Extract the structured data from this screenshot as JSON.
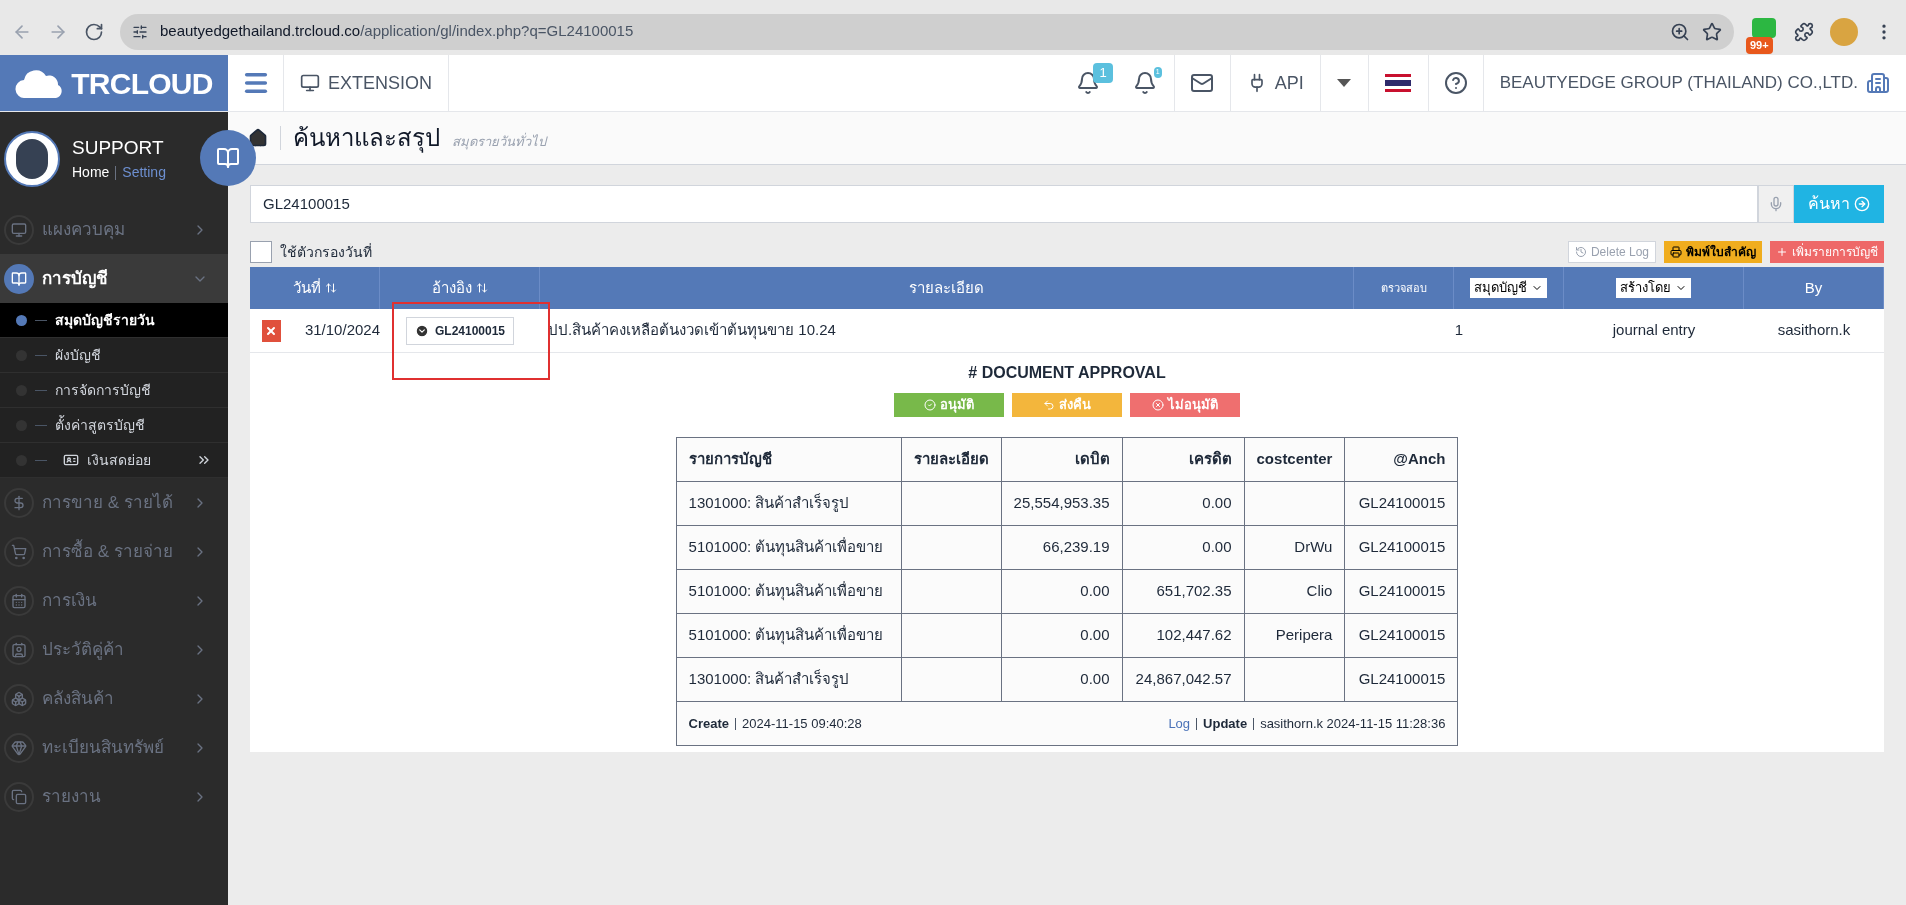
{
  "browser": {
    "url_host": "beautyedgethailand.trcloud.co",
    "url_path": "/application/gl/index.php?q=GL24100015",
    "extension_badge": "99+"
  },
  "topbar": {
    "logo": "TRCLOUD",
    "extension": "EXTENSION",
    "notifications": [
      "1",
      "1"
    ],
    "api": "API",
    "company": "BEAUTYEDGE GROUP (THAILAND) CO.,LTD."
  },
  "profile": {
    "name": "SUPPORT",
    "links": [
      "Home",
      "Setting"
    ]
  },
  "sidebar": {
    "items": [
      {
        "label": "แผงควบคุม",
        "expanded": false
      },
      {
        "label": "การบัญชี",
        "expanded": true,
        "children": [
          {
            "label": "สมุดบัญชีรายวัน",
            "selected": true,
            "kind": "link"
          },
          {
            "label": "ผังบัญชี",
            "selected": false,
            "kind": "link"
          },
          {
            "label": "การจัดการบัญชี",
            "selected": false,
            "kind": "link"
          },
          {
            "label": "ตั้งค่าสูตรบัญชี",
            "selected": false,
            "kind": "link"
          },
          {
            "label": "เงินสดย่อย",
            "selected": false,
            "kind": "group"
          }
        ]
      },
      {
        "label": "การขาย & รายได้",
        "expanded": false
      },
      {
        "label": "การซื้อ & รายจ่าย",
        "expanded": false
      },
      {
        "label": "การเงิน",
        "expanded": false
      },
      {
        "label": "ประวัติคู่ค้า",
        "expanded": false
      },
      {
        "label": "คลังสินค้า",
        "expanded": false
      },
      {
        "label": "ทะเบียนสินทรัพย์",
        "expanded": false
      },
      {
        "label": "รายงาน",
        "expanded": false
      }
    ]
  },
  "page": {
    "title": "ค้นหาและสรุป",
    "subtitle": "สมุดรายวันทั่วไป"
  },
  "search": {
    "value": "GL24100015",
    "button": "ค้นหา"
  },
  "filter": {
    "label": "ใช้ตัวกรองวันที่",
    "checked": false
  },
  "actions": [
    {
      "label": "Delete Log",
      "kind": "log"
    },
    {
      "label": "พิมพ์ใบสำคัญ",
      "kind": "print"
    },
    {
      "label": "เพิ่มรายการบัญชี",
      "kind": "add"
    }
  ],
  "table": {
    "columns": [
      {
        "label": "วันที่",
        "kind": "sort"
      },
      {
        "label": "อ้างอิง",
        "kind": "sort"
      },
      {
        "label": "รายละเอียด",
        "kind": "plain"
      },
      {
        "label": "ตรวจสอบ",
        "kind": "small"
      },
      {
        "label": "สมุดบัญชี",
        "kind": "select"
      },
      {
        "label": "สร้างโดย",
        "kind": "select"
      },
      {
        "label": "By",
        "kind": "plain"
      }
    ],
    "rows": [
      {
        "date": "31/10/2024",
        "ref": "GL24100015",
        "ref_marked": true,
        "detail": "ปป.สินค้าคงเหลือต้นงวดเข้าต้นทุนขาย 10.24",
        "check": "1",
        "created_by": "journal entry",
        "by": "sasithorn.k"
      }
    ]
  },
  "approval": {
    "title": "# DOCUMENT APPROVAL",
    "buttons": [
      {
        "label": "อนุมัติ",
        "kind": "approve"
      },
      {
        "label": "ส่งคืน",
        "kind": "return"
      },
      {
        "label": "ไม่อนุมัติ",
        "kind": "reject"
      }
    ]
  },
  "entries": {
    "columns": [
      "รายการบัญชี",
      "รายละเอียด",
      "เดบิต",
      "เครดิต",
      "costcenter",
      "@Anch"
    ],
    "rows": [
      [
        "1301000: สินค้าสำเร็จรูป",
        "",
        "25,554,953.35",
        "0.00",
        "",
        "GL24100015"
      ],
      [
        "5101000: ต้นทุนสินค้าเพื่อขาย",
        "",
        "66,239.19",
        "0.00",
        "DrWu",
        "GL24100015"
      ],
      [
        "5101000: ต้นทุนสินค้าเพื่อขาย",
        "",
        "0.00",
        "651,702.35",
        "Clio",
        "GL24100015"
      ],
      [
        "5101000: ต้นทุนสินค้าเพื่อขาย",
        "",
        "0.00",
        "102,447.62",
        "Peripera",
        "GL24100015"
      ],
      [
        "1301000: สินค้าสำเร็จรูป",
        "",
        "0.00",
        "24,867,042.57",
        "",
        "GL24100015"
      ]
    ],
    "footer": {
      "create_label": "Create",
      "create_time": "2024-11-15 09:40:28",
      "log": "Log",
      "update_label": "Update",
      "update_info": "sasithorn.k 2024-11-15 11:28:36"
    }
  }
}
